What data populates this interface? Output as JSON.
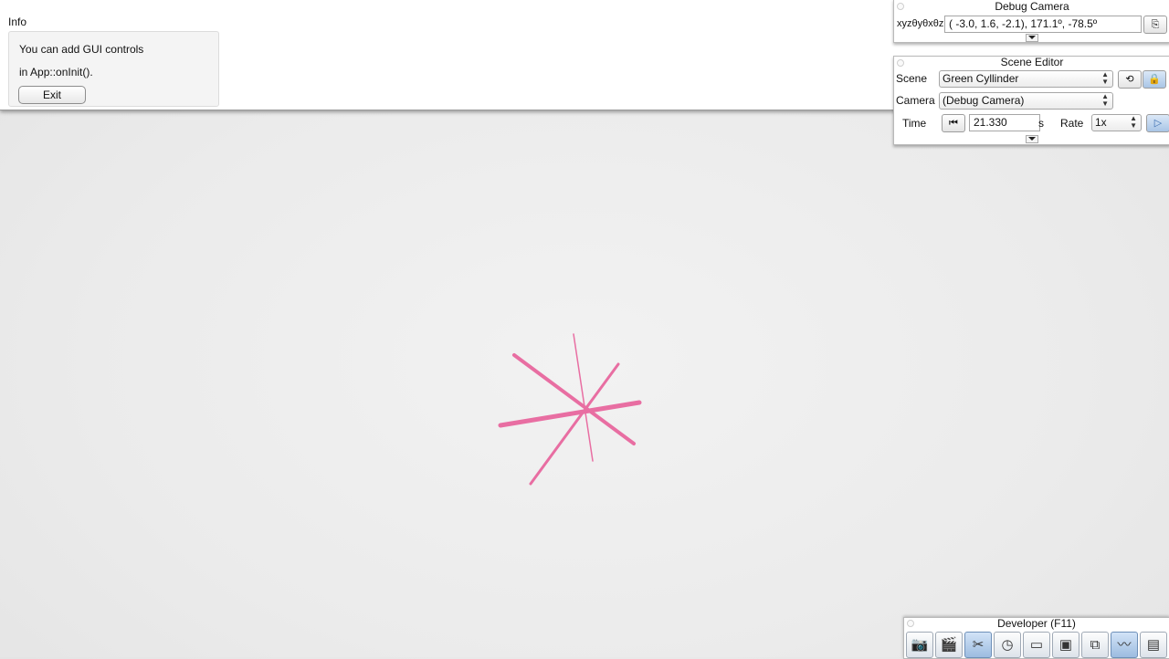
{
  "info": {
    "title": "Info",
    "line1": "You can add GUI controls",
    "line2": "in App::onInit().",
    "exit_label": "Exit"
  },
  "debug_camera": {
    "title": "Debug Camera",
    "label": "xyzθyθxθz",
    "value": "( -3.0,   1.6,  -2.1),  171.1º, -78.5º"
  },
  "scene_editor": {
    "title": "Scene Editor",
    "scene_label": "Scene",
    "scene_value": "Green Cyllinder",
    "camera_label": "Camera",
    "camera_value": "(Debug Camera)",
    "time_label": "Time",
    "time_value": "21.330",
    "time_unit": "s",
    "rate_label": "Rate",
    "rate_value": "1x"
  },
  "developer": {
    "title": "Developer (F11)",
    "icons": [
      "camera-icon",
      "clapperboard-icon",
      "tools-icon",
      "clock-icon",
      "window-icon",
      "terminal-icon",
      "scene-graph-icon",
      "profiler-icon",
      "document-icon"
    ]
  },
  "colors": {
    "accent": "#8fb3df",
    "scene_object": "#e8609a"
  }
}
